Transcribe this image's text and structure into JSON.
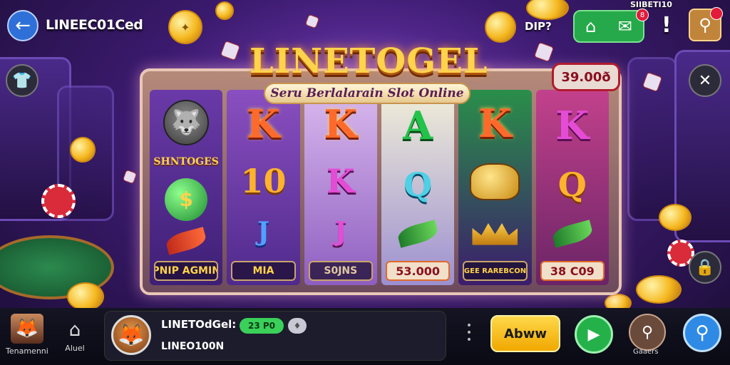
{
  "header": {
    "app_title": "LINEEC01Ced",
    "top_text": "DIP?",
    "corner_id": "SIIBETI10",
    "notification_badge": "8"
  },
  "game": {
    "logo": "LINETOGEL",
    "subtitle": "Seru Berlalarain Slot Online",
    "balance": "39.00ð",
    "reels": [
      {
        "label": "PNIP AGMIN",
        "top_label": "SHNTOGES"
      },
      {
        "label": "MIA",
        "top": "K",
        "mid": "10",
        "low": "J"
      },
      {
        "label": "S0JNS",
        "top": "K",
        "mid": "K",
        "low": "J"
      },
      {
        "label": "53.000",
        "top": "A",
        "mid": "Q"
      },
      {
        "label": "GEE RAREBCON",
        "top": "K"
      },
      {
        "label": "38 C09",
        "top": "K",
        "mid": "Q"
      }
    ]
  },
  "bottom": {
    "nav_tournament": "Tenamenni",
    "nav_home": "Aluel",
    "player_name": "LINETOdGel:",
    "player_chip": "23 P0",
    "player_sub": "LINEO100N",
    "action_label": "Abww",
    "search_caption": "Gaaers"
  },
  "colors": {
    "accent_green": "#26a94a",
    "accent_blue": "#2f8ae6",
    "action_yellow": "#ffd84a",
    "logo_gold": "#ffd34a"
  },
  "icons": [
    "back-arrow-icon",
    "shirt-icon",
    "home-icon",
    "message-icon",
    "alert-icon",
    "user-icon",
    "close-icon",
    "lock-icon",
    "play-icon",
    "search-icon"
  ]
}
